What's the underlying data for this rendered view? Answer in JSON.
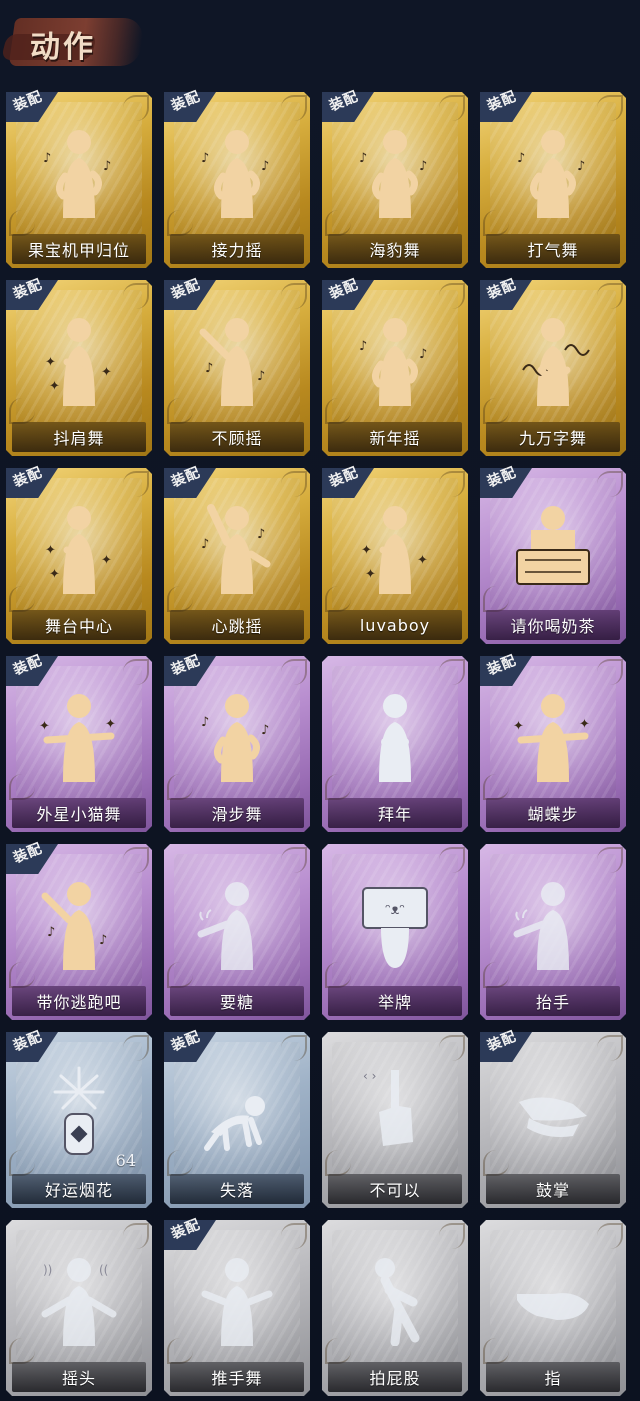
{
  "header": {
    "title": "动作"
  },
  "badge_text": "装配",
  "colors": {
    "gold": "#d7ae3e",
    "purple": "#b98fd0",
    "blue": "#9fb2c7",
    "gray": "#b9b9bd",
    "figure_gold": "#f2d3a3",
    "figure_light": "#e9edf3"
  },
  "actions": [
    {
      "label": "果宝机甲归位",
      "rarity": "gold",
      "equipped": true,
      "icon": "dancer-music-icon"
    },
    {
      "label": "接力摇",
      "rarity": "gold",
      "equipped": true,
      "icon": "dancer-music-icon"
    },
    {
      "label": "海豹舞",
      "rarity": "gold",
      "equipped": true,
      "icon": "dancer-music-icon"
    },
    {
      "label": "打气舞",
      "rarity": "gold",
      "equipped": true,
      "icon": "dancer-music-icon"
    },
    {
      "label": "抖肩舞",
      "rarity": "gold",
      "equipped": true,
      "icon": "dancer-stars-icon"
    },
    {
      "label": "不顾摇",
      "rarity": "gold",
      "equipped": true,
      "icon": "dancer-point-icon"
    },
    {
      "label": "新年摇",
      "rarity": "gold",
      "equipped": true,
      "icon": "dancer-music-icon"
    },
    {
      "label": "九万字舞",
      "rarity": "gold",
      "equipped": true,
      "icon": "dancer-swirl-icon"
    },
    {
      "label": "舞台中心",
      "rarity": "gold",
      "equipped": true,
      "icon": "dancer-stars-icon"
    },
    {
      "label": "心跳摇",
      "rarity": "gold",
      "equipped": true,
      "icon": "dancer-wave-icon"
    },
    {
      "label": "luvaboy",
      "rarity": "gold",
      "equipped": true,
      "icon": "dancer-stars-icon"
    },
    {
      "label": "请你喝奶茶",
      "rarity": "purple",
      "equipped": true,
      "icon": "sign-holder-icon"
    },
    {
      "label": "外星小猫舞",
      "rarity": "purple",
      "equipped": true,
      "icon": "dancer-arms-out-icon"
    },
    {
      "label": "滑步舞",
      "rarity": "purple",
      "equipped": true,
      "icon": "dancer-music-icon"
    },
    {
      "label": "拜年",
      "rarity": "purple",
      "equipped": false,
      "icon": "bow-figure-icon"
    },
    {
      "label": "蝴蝶步",
      "rarity": "purple",
      "equipped": true,
      "icon": "dancer-arms-out-icon"
    },
    {
      "label": "带你逃跑吧",
      "rarity": "purple",
      "equipped": true,
      "icon": "dancer-point-icon"
    },
    {
      "label": "要糖",
      "rarity": "purple",
      "equipped": false,
      "icon": "reach-figure-icon"
    },
    {
      "label": "举牌",
      "rarity": "purple",
      "equipped": false,
      "icon": "cat-sign-icon"
    },
    {
      "label": "抬手",
      "rarity": "purple",
      "equipped": false,
      "icon": "reach-figure-icon"
    },
    {
      "label": "好运烟花",
      "rarity": "blue",
      "equipped": true,
      "icon": "firework-icon",
      "count": "64"
    },
    {
      "label": "失落",
      "rarity": "blue",
      "equipped": true,
      "icon": "crawl-figure-icon"
    },
    {
      "label": "不可以",
      "rarity": "gray",
      "equipped": false,
      "icon": "finger-wag-icon"
    },
    {
      "label": "鼓掌",
      "rarity": "gray",
      "equipped": true,
      "icon": "clap-hands-icon"
    },
    {
      "label": "摇头",
      "rarity": "gray",
      "equipped": false,
      "icon": "head-shake-icon"
    },
    {
      "label": "推手舞",
      "rarity": "gray",
      "equipped": true,
      "icon": "push-figure-icon"
    },
    {
      "label": "拍屁股",
      "rarity": "gray",
      "equipped": false,
      "icon": "butt-pat-icon"
    },
    {
      "label": "指",
      "rarity": "gray",
      "equipped": false,
      "icon": "point-hand-icon"
    }
  ]
}
